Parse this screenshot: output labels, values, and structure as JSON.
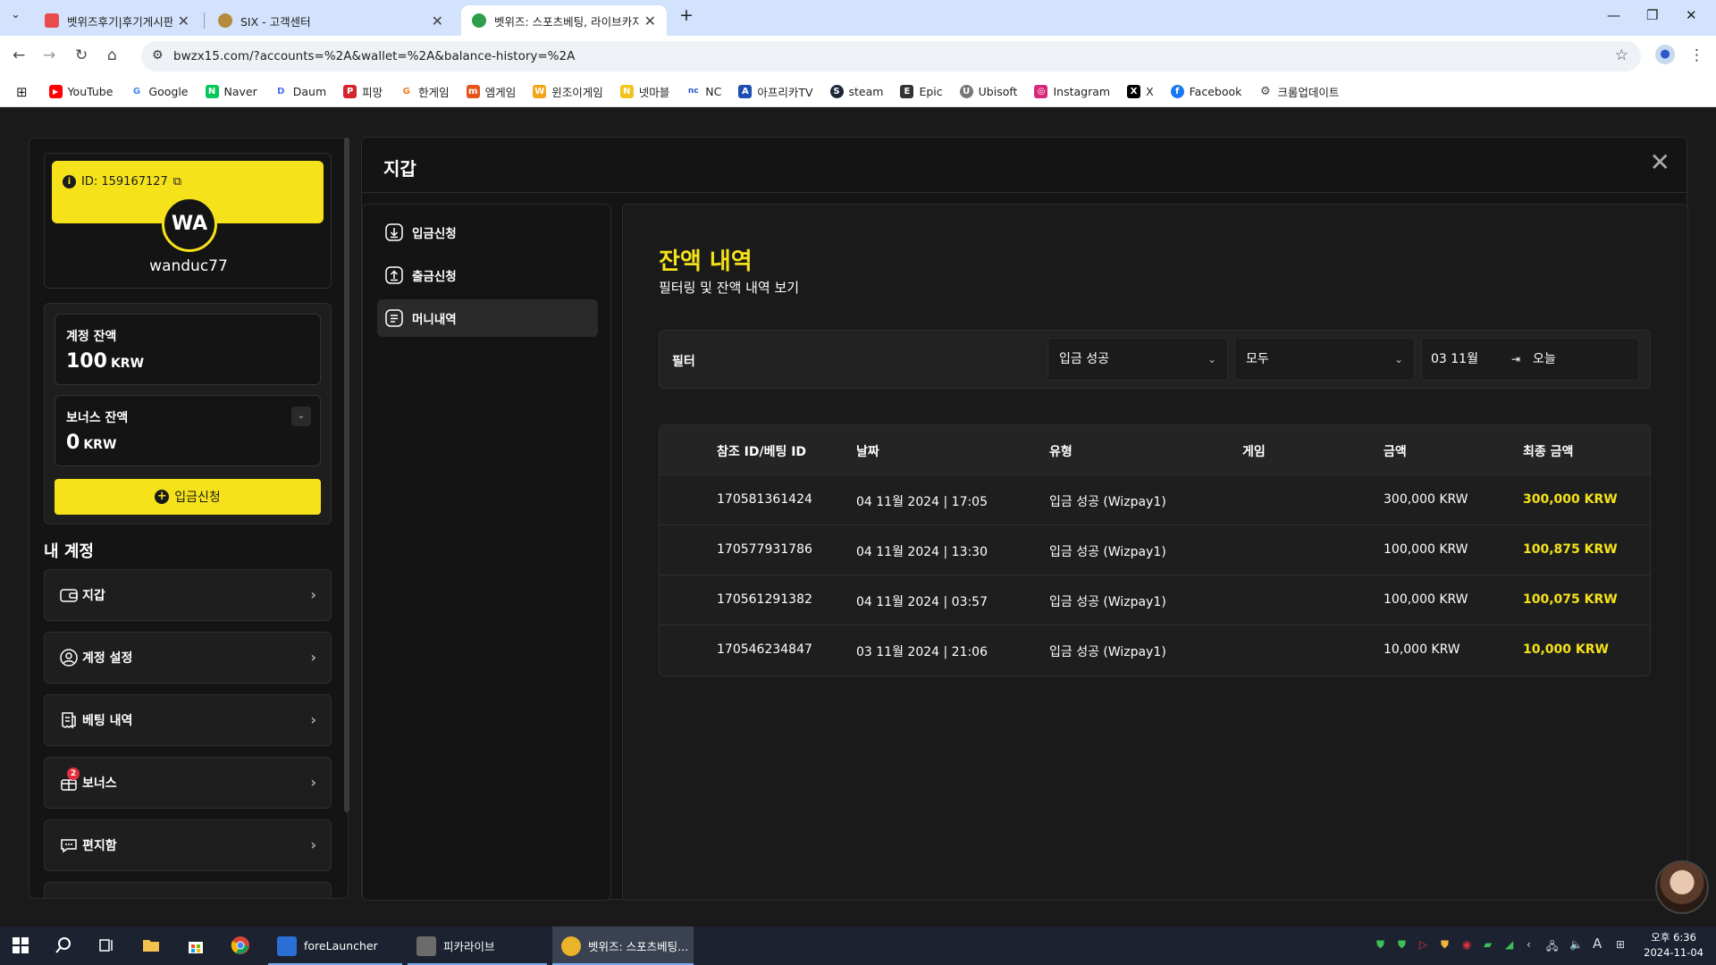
{
  "browser": {
    "tabs": [
      {
        "label": "벳위즈후기|후기게시판",
        "color": "#e94a4a"
      },
      {
        "label": "SIX - 고객센터",
        "color": "#b58a3a"
      },
      {
        "label": "벳위즈: 스포츠베팅, 라이브카지",
        "color": "#2e9e4a"
      }
    ],
    "url": "bwzx15.com/?accounts=%2A&wallet=%2A&balance-history=%2A",
    "bookmarks": [
      {
        "label": "YouTube",
        "color": "#ff0000",
        "glyph": "▶"
      },
      {
        "label": "Google",
        "color": "#4285f4",
        "glyph": "G"
      },
      {
        "label": "Naver",
        "color": "#03c75a",
        "glyph": "N"
      },
      {
        "label": "Daum",
        "color": "#4a6cf7",
        "glyph": "D"
      },
      {
        "label": "피망",
        "color": "#d4242e",
        "glyph": "P"
      },
      {
        "label": "한게임",
        "color": "#f07b19",
        "glyph": "G"
      },
      {
        "label": "엠게임",
        "color": "#e4541b",
        "glyph": "m"
      },
      {
        "label": "윈조이게임",
        "color": "#f2a51a",
        "glyph": "W"
      },
      {
        "label": "넷마블",
        "color": "#f4c21d",
        "glyph": "N"
      },
      {
        "label": "NC",
        "color": "#2b53c9",
        "glyph": "nc"
      },
      {
        "label": "아프리카TV",
        "color": "#1b4fb2",
        "glyph": "A"
      },
      {
        "label": "steam",
        "color": "#1b2838",
        "glyph": "S"
      },
      {
        "label": "Epic",
        "color": "#333333",
        "glyph": "E"
      },
      {
        "label": "Ubisoft",
        "color": "#555555",
        "glyph": "U"
      },
      {
        "label": "Instagram",
        "color": "#d62976",
        "glyph": "◎"
      },
      {
        "label": "X",
        "color": "#000000",
        "glyph": "X"
      },
      {
        "label": "Facebook",
        "color": "#1877f2",
        "glyph": "f"
      },
      {
        "label": "크롬업데이트",
        "color": "#444444",
        "glyph": "⚙"
      }
    ]
  },
  "profile": {
    "id_label": "ID: 159167127",
    "avatar_initials": "WA",
    "username": "wanduc77"
  },
  "balances": {
    "account_title": "계정 잔액",
    "account_value": "100",
    "account_currency": "KRW",
    "bonus_title": "보너스 잔액",
    "bonus_value": "0",
    "bonus_currency": "KRW",
    "deposit_button": "입금신청"
  },
  "my_account": {
    "heading": "내 계정",
    "items": [
      {
        "label": "지갑",
        "icon": "wallet-icon"
      },
      {
        "label": "계정 설정",
        "icon": "user-icon"
      },
      {
        "label": "베팅 내역",
        "icon": "receipt-icon"
      },
      {
        "label": "보너스",
        "icon": "gift-icon",
        "badge": "2"
      },
      {
        "label": "편지함",
        "icon": "chat-icon"
      }
    ]
  },
  "wallet": {
    "title": "지갑",
    "nav": [
      {
        "label": "입금신청",
        "icon": "download-icon"
      },
      {
        "label": "출금신청",
        "icon": "upload-icon"
      },
      {
        "label": "머니내역",
        "icon": "document-icon"
      }
    ],
    "balance_history": {
      "title": "잔액 내역",
      "subtitle": "필터링 및 잔액 내역 보기",
      "filter_label": "필터",
      "filter_type": "입금 성공",
      "filter_scope": "모두",
      "date_from": "03 11월",
      "date_to": "오늘",
      "columns": [
        "참조 ID/베팅 ID",
        "날짜",
        "유형",
        "게임",
        "금액",
        "최종 금액"
      ],
      "rows": [
        {
          "ref": "170581361424",
          "date": "04 11월 2024 | 17:05",
          "type": "입금 성공 (Wizpay1)",
          "game": "",
          "amount": "300,000 KRW",
          "final": "300,000 KRW"
        },
        {
          "ref": "170577931786",
          "date": "04 11월 2024 | 13:30",
          "type": "입금 성공 (Wizpay1)",
          "game": "",
          "amount": "100,000 KRW",
          "final": "100,875 KRW"
        },
        {
          "ref": "170561291382",
          "date": "04 11월 2024 | 03:57",
          "type": "입금 성공 (Wizpay1)",
          "game": "",
          "amount": "100,000 KRW",
          "final": "100,075 KRW"
        },
        {
          "ref": "170546234847",
          "date": "03 11월 2024 | 21:06",
          "type": "입금 성공 (Wizpay1)",
          "game": "",
          "amount": "10,000 KRW",
          "final": "10,000 KRW"
        }
      ]
    }
  },
  "taskbar": {
    "apps": [
      {
        "label": "foreLauncher",
        "color": "#2a6fd6"
      },
      {
        "label": "피카라이브",
        "color": "#6b6b6b"
      },
      {
        "label": "벳위즈: 스포츠베팅...",
        "color": "#e9b32a"
      }
    ],
    "time": "오후 6:36",
    "date": "2024-11-04",
    "ime": "A"
  },
  "colors": {
    "accent": "#f5e21b",
    "panel": "#141414",
    "bg": "#1a1a1a"
  }
}
